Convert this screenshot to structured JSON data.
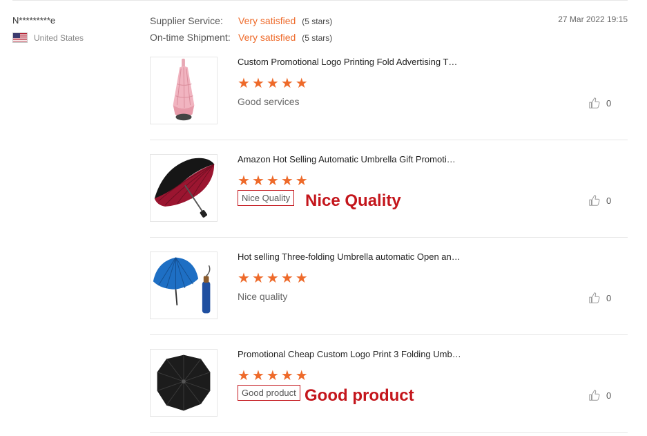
{
  "reviewer": {
    "name": "N*********e",
    "country": "United States",
    "flag_icon": "us-flag-icon"
  },
  "ratings": [
    {
      "label": "Supplier Service:",
      "value": "Very satisfied",
      "stars_text": "(5 stars)"
    },
    {
      "label": "On-time Shipment:",
      "value": "Very satisfied",
      "stars_text": "(5 stars)"
    }
  ],
  "date": "27 Mar 2022 19:15",
  "items": [
    {
      "title": "Custom Promotional Logo Printing Fold Advertising T…",
      "rating": 5,
      "comment": "Good services",
      "likes": "0",
      "image": "pink-folded-umbrella"
    },
    {
      "title": "Amazon Hot Selling Automatic Umbrella Gift Promoti…",
      "rating": 5,
      "comment": "Nice Quality",
      "annotation": "Nice Quality",
      "likes": "0",
      "image": "black-red-open-umbrella"
    },
    {
      "title": "Hot selling Three-folding Umbrella automatic Open an…",
      "rating": 5,
      "comment": "Nice quality",
      "likes": "0",
      "image": "blue-umbrella-with-sleeve"
    },
    {
      "title": "Promotional Cheap Custom Logo Print 3 Folding Umb…",
      "rating": 5,
      "comment": "Good product",
      "annotation": "Good product",
      "likes": "0",
      "image": "black-open-umbrella"
    }
  ],
  "colors": {
    "accent": "#ee6a2a",
    "annotation": "#c4161c"
  }
}
